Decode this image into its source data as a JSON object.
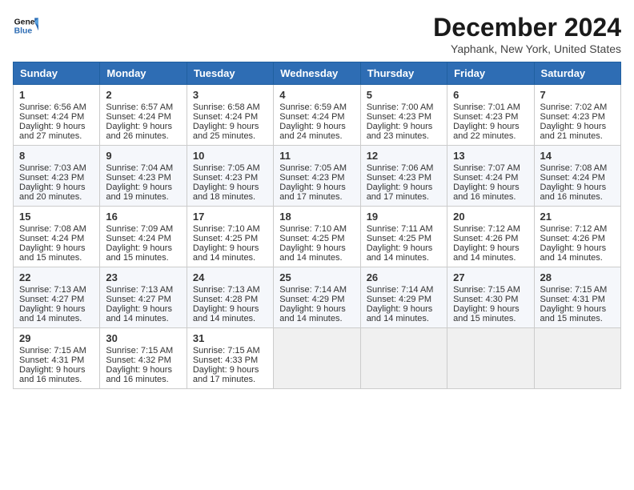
{
  "header": {
    "logo_line1": "General",
    "logo_line2": "Blue",
    "month": "December 2024",
    "location": "Yaphank, New York, United States"
  },
  "weekdays": [
    "Sunday",
    "Monday",
    "Tuesday",
    "Wednesday",
    "Thursday",
    "Friday",
    "Saturday"
  ],
  "weeks": [
    [
      {
        "day": "1",
        "sunrise": "6:56 AM",
        "sunset": "4:24 PM",
        "daylight": "9 hours and 27 minutes."
      },
      {
        "day": "2",
        "sunrise": "6:57 AM",
        "sunset": "4:24 PM",
        "daylight": "9 hours and 26 minutes."
      },
      {
        "day": "3",
        "sunrise": "6:58 AM",
        "sunset": "4:24 PM",
        "daylight": "9 hours and 25 minutes."
      },
      {
        "day": "4",
        "sunrise": "6:59 AM",
        "sunset": "4:24 PM",
        "daylight": "9 hours and 24 minutes."
      },
      {
        "day": "5",
        "sunrise": "7:00 AM",
        "sunset": "4:23 PM",
        "daylight": "9 hours and 23 minutes."
      },
      {
        "day": "6",
        "sunrise": "7:01 AM",
        "sunset": "4:23 PM",
        "daylight": "9 hours and 22 minutes."
      },
      {
        "day": "7",
        "sunrise": "7:02 AM",
        "sunset": "4:23 PM",
        "daylight": "9 hours and 21 minutes."
      }
    ],
    [
      {
        "day": "8",
        "sunrise": "7:03 AM",
        "sunset": "4:23 PM",
        "daylight": "9 hours and 20 minutes."
      },
      {
        "day": "9",
        "sunrise": "7:04 AM",
        "sunset": "4:23 PM",
        "daylight": "9 hours and 19 minutes."
      },
      {
        "day": "10",
        "sunrise": "7:05 AM",
        "sunset": "4:23 PM",
        "daylight": "9 hours and 18 minutes."
      },
      {
        "day": "11",
        "sunrise": "7:05 AM",
        "sunset": "4:23 PM",
        "daylight": "9 hours and 17 minutes."
      },
      {
        "day": "12",
        "sunrise": "7:06 AM",
        "sunset": "4:23 PM",
        "daylight": "9 hours and 17 minutes."
      },
      {
        "day": "13",
        "sunrise": "7:07 AM",
        "sunset": "4:24 PM",
        "daylight": "9 hours and 16 minutes."
      },
      {
        "day": "14",
        "sunrise": "7:08 AM",
        "sunset": "4:24 PM",
        "daylight": "9 hours and 16 minutes."
      }
    ],
    [
      {
        "day": "15",
        "sunrise": "7:08 AM",
        "sunset": "4:24 PM",
        "daylight": "9 hours and 15 minutes."
      },
      {
        "day": "16",
        "sunrise": "7:09 AM",
        "sunset": "4:24 PM",
        "daylight": "9 hours and 15 minutes."
      },
      {
        "day": "17",
        "sunrise": "7:10 AM",
        "sunset": "4:25 PM",
        "daylight": "9 hours and 14 minutes."
      },
      {
        "day": "18",
        "sunrise": "7:10 AM",
        "sunset": "4:25 PM",
        "daylight": "9 hours and 14 minutes."
      },
      {
        "day": "19",
        "sunrise": "7:11 AM",
        "sunset": "4:25 PM",
        "daylight": "9 hours and 14 minutes."
      },
      {
        "day": "20",
        "sunrise": "7:12 AM",
        "sunset": "4:26 PM",
        "daylight": "9 hours and 14 minutes."
      },
      {
        "day": "21",
        "sunrise": "7:12 AM",
        "sunset": "4:26 PM",
        "daylight": "9 hours and 14 minutes."
      }
    ],
    [
      {
        "day": "22",
        "sunrise": "7:13 AM",
        "sunset": "4:27 PM",
        "daylight": "9 hours and 14 minutes."
      },
      {
        "day": "23",
        "sunrise": "7:13 AM",
        "sunset": "4:27 PM",
        "daylight": "9 hours and 14 minutes."
      },
      {
        "day": "24",
        "sunrise": "7:13 AM",
        "sunset": "4:28 PM",
        "daylight": "9 hours and 14 minutes."
      },
      {
        "day": "25",
        "sunrise": "7:14 AM",
        "sunset": "4:29 PM",
        "daylight": "9 hours and 14 minutes."
      },
      {
        "day": "26",
        "sunrise": "7:14 AM",
        "sunset": "4:29 PM",
        "daylight": "9 hours and 14 minutes."
      },
      {
        "day": "27",
        "sunrise": "7:15 AM",
        "sunset": "4:30 PM",
        "daylight": "9 hours and 15 minutes."
      },
      {
        "day": "28",
        "sunrise": "7:15 AM",
        "sunset": "4:31 PM",
        "daylight": "9 hours and 15 minutes."
      }
    ],
    [
      {
        "day": "29",
        "sunrise": "7:15 AM",
        "sunset": "4:31 PM",
        "daylight": "9 hours and 16 minutes."
      },
      {
        "day": "30",
        "sunrise": "7:15 AM",
        "sunset": "4:32 PM",
        "daylight": "9 hours and 16 minutes."
      },
      {
        "day": "31",
        "sunrise": "7:15 AM",
        "sunset": "4:33 PM",
        "daylight": "9 hours and 17 minutes."
      },
      null,
      null,
      null,
      null
    ]
  ],
  "labels": {
    "sunrise": "Sunrise:",
    "sunset": "Sunset:",
    "daylight": "Daylight:"
  }
}
